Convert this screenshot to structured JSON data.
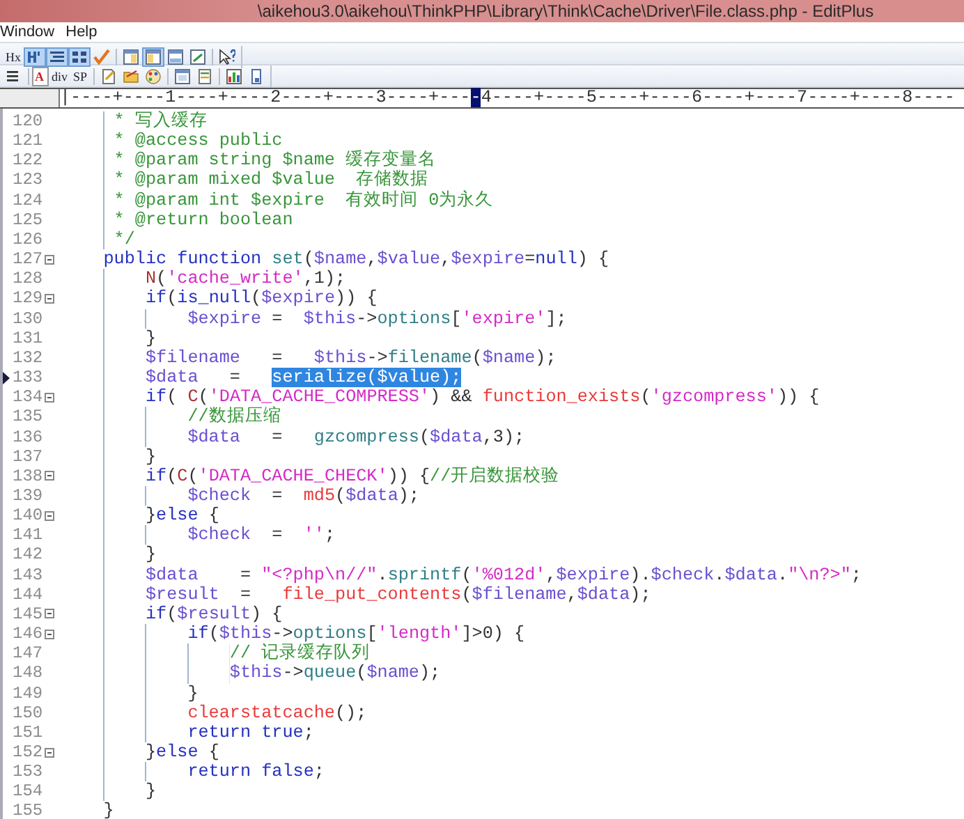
{
  "window": {
    "title": "\\aikehou3.0\\aikehou\\ThinkPHP\\Library\\Think\\Cache\\Driver\\File.class.php - EditPlus"
  },
  "menu": [
    "Window",
    "Help"
  ],
  "toolbars": [
    {
      "items": [
        {
          "kind": "text",
          "label": "Hx",
          "pressed": false
        },
        {
          "kind": "icon",
          "pressed": true
        },
        {
          "kind": "icon",
          "pressed": true
        },
        {
          "kind": "icon",
          "pressed": true
        },
        {
          "kind": "icon",
          "pressed": false
        },
        {
          "kind": "separator"
        },
        {
          "kind": "icon",
          "pressed": false
        },
        {
          "kind": "icon",
          "pressed": true
        },
        {
          "kind": "icon",
          "pressed": false
        },
        {
          "kind": "icon",
          "pressed": false
        },
        {
          "kind": "separator"
        },
        {
          "kind": "icon",
          "pressed": false
        }
      ]
    },
    {
      "items": [
        {
          "kind": "icon",
          "pressed": false
        },
        {
          "kind": "separator"
        },
        {
          "kind": "boxed",
          "label": "A",
          "pressed": false
        },
        {
          "kind": "text",
          "label": "div",
          "pressed": false
        },
        {
          "kind": "text",
          "label": "SP",
          "pressed": false
        },
        {
          "kind": "separator"
        },
        {
          "kind": "icon",
          "pressed": false
        },
        {
          "kind": "icon",
          "pressed": false
        },
        {
          "kind": "icon",
          "pressed": false
        },
        {
          "kind": "separator"
        },
        {
          "kind": "icon",
          "pressed": false
        },
        {
          "kind": "icon",
          "pressed": false
        },
        {
          "kind": "separator"
        },
        {
          "kind": "icon",
          "pressed": false
        },
        {
          "kind": "icon",
          "pressed": false
        }
      ]
    }
  ],
  "ruler": {
    "before": "|----+----1----+----2----+----3----+---",
    "mark": "-",
    "after": "4----+----5----+----6----+----7----+----8----"
  },
  "editor": {
    "lines": [
      {
        "number": "120",
        "foldable": false,
        "current": false,
        "tokens": [
          {
            "kind": "comment",
            "text": "     * 写入缓存"
          }
        ]
      },
      {
        "number": "121",
        "foldable": false,
        "current": false,
        "tokens": [
          {
            "kind": "comment",
            "text": "     * @access public"
          }
        ]
      },
      {
        "number": "122",
        "foldable": false,
        "current": false,
        "tokens": [
          {
            "kind": "comment",
            "text": "     * @param string $name 缓存变量名"
          }
        ]
      },
      {
        "number": "123",
        "foldable": false,
        "current": false,
        "tokens": [
          {
            "kind": "comment",
            "text": "     * @param mixed $value  存储数据"
          }
        ]
      },
      {
        "number": "124",
        "foldable": false,
        "current": false,
        "tokens": [
          {
            "kind": "comment",
            "text": "     * @param int $expire  有效时间 0为永久"
          }
        ]
      },
      {
        "number": "125",
        "foldable": false,
        "current": false,
        "tokens": [
          {
            "kind": "comment",
            "text": "     * @return boolean"
          }
        ]
      },
      {
        "number": "126",
        "foldable": false,
        "current": false,
        "tokens": [
          {
            "kind": "comment",
            "text": "     */"
          }
        ]
      },
      {
        "number": "127",
        "foldable": true,
        "current": false,
        "tokens": [
          {
            "kind": "keyword",
            "text": "    public"
          },
          {
            "kind": "keyword",
            "text": " function"
          },
          {
            "kind": "ident",
            "text": " set"
          },
          {
            "kind": "plain",
            "text": "("
          },
          {
            "kind": "var",
            "text": "$name"
          },
          {
            "kind": "plain",
            "text": ","
          },
          {
            "kind": "var",
            "text": "$value"
          },
          {
            "kind": "plain",
            "text": ","
          },
          {
            "kind": "var",
            "text": "$expire"
          },
          {
            "kind": "plain",
            "text": "="
          },
          {
            "kind": "keyword",
            "text": "null"
          },
          {
            "kind": "plain",
            "text": ") {"
          }
        ]
      },
      {
        "number": "128",
        "foldable": false,
        "current": false,
        "tokens": [
          {
            "kind": "macro",
            "text": "        N"
          },
          {
            "kind": "plain",
            "text": "("
          },
          {
            "kind": "string",
            "text": "'cache_write'"
          },
          {
            "kind": "plain",
            "text": ",1);"
          }
        ]
      },
      {
        "number": "129",
        "foldable": true,
        "current": false,
        "tokens": [
          {
            "kind": "keyword",
            "text": "        if"
          },
          {
            "kind": "plain",
            "text": "("
          },
          {
            "kind": "keyword",
            "text": "is_null"
          },
          {
            "kind": "plain",
            "text": "("
          },
          {
            "kind": "var",
            "text": "$expire"
          },
          {
            "kind": "plain",
            "text": ")) {"
          }
        ]
      },
      {
        "number": "130",
        "foldable": false,
        "current": false,
        "tokens": [
          {
            "kind": "var",
            "text": "            $expire"
          },
          {
            "kind": "plain",
            "text": " =  "
          },
          {
            "kind": "var",
            "text": "$this"
          },
          {
            "kind": "plain",
            "text": "->"
          },
          {
            "kind": "ident",
            "text": "options"
          },
          {
            "kind": "plain",
            "text": "["
          },
          {
            "kind": "string",
            "text": "'expire'"
          },
          {
            "kind": "plain",
            "text": "];"
          }
        ]
      },
      {
        "number": "131",
        "foldable": false,
        "current": false,
        "tokens": [
          {
            "kind": "plain",
            "text": "        }"
          }
        ]
      },
      {
        "number": "132",
        "foldable": false,
        "current": false,
        "tokens": [
          {
            "kind": "var",
            "text": "        $filename"
          },
          {
            "kind": "plain",
            "text": "   =   "
          },
          {
            "kind": "var",
            "text": "$this"
          },
          {
            "kind": "plain",
            "text": "->"
          },
          {
            "kind": "ident",
            "text": "filename"
          },
          {
            "kind": "plain",
            "text": "("
          },
          {
            "kind": "var",
            "text": "$name"
          },
          {
            "kind": "plain",
            "text": ");"
          }
        ]
      },
      {
        "number": "133",
        "foldable": false,
        "current": true,
        "tokens": [
          {
            "kind": "var",
            "text": "        $data"
          },
          {
            "kind": "plain",
            "text": "   =   "
          },
          {
            "kind": "selection",
            "text": "serialize($value);"
          }
        ]
      },
      {
        "number": "134",
        "foldable": true,
        "current": false,
        "tokens": [
          {
            "kind": "keyword",
            "text": "        if"
          },
          {
            "kind": "plain",
            "text": "( "
          },
          {
            "kind": "macro",
            "text": "C"
          },
          {
            "kind": "plain",
            "text": "("
          },
          {
            "kind": "string",
            "text": "'DATA_CACHE_COMPRESS'"
          },
          {
            "kind": "plain",
            "text": ") && "
          },
          {
            "kind": "builtin",
            "text": "function_exists"
          },
          {
            "kind": "plain",
            "text": "("
          },
          {
            "kind": "string",
            "text": "'gzcompress'"
          },
          {
            "kind": "plain",
            "text": ")) {"
          }
        ]
      },
      {
        "number": "135",
        "foldable": false,
        "current": false,
        "tokens": [
          {
            "kind": "comment",
            "text": "            //数据压缩"
          }
        ]
      },
      {
        "number": "136",
        "foldable": false,
        "current": false,
        "tokens": [
          {
            "kind": "var",
            "text": "            $data"
          },
          {
            "kind": "plain",
            "text": "   =   "
          },
          {
            "kind": "ident",
            "text": "gzcompress"
          },
          {
            "kind": "plain",
            "text": "("
          },
          {
            "kind": "var",
            "text": "$data"
          },
          {
            "kind": "plain",
            "text": ",3);"
          }
        ]
      },
      {
        "number": "137",
        "foldable": false,
        "current": false,
        "tokens": [
          {
            "kind": "plain",
            "text": "        }"
          }
        ]
      },
      {
        "number": "138",
        "foldable": true,
        "current": false,
        "tokens": [
          {
            "kind": "keyword",
            "text": "        if"
          },
          {
            "kind": "plain",
            "text": "("
          },
          {
            "kind": "macro",
            "text": "C"
          },
          {
            "kind": "plain",
            "text": "("
          },
          {
            "kind": "string",
            "text": "'DATA_CACHE_CHECK'"
          },
          {
            "kind": "plain",
            "text": ")) {"
          },
          {
            "kind": "comment",
            "text": "//开启数据校验"
          }
        ]
      },
      {
        "number": "139",
        "foldable": false,
        "current": false,
        "tokens": [
          {
            "kind": "var",
            "text": "            $check"
          },
          {
            "kind": "plain",
            "text": "  =  "
          },
          {
            "kind": "builtin",
            "text": "md5"
          },
          {
            "kind": "plain",
            "text": "("
          },
          {
            "kind": "var",
            "text": "$data"
          },
          {
            "kind": "plain",
            "text": ");"
          }
        ]
      },
      {
        "number": "140",
        "foldable": true,
        "current": false,
        "tokens": [
          {
            "kind": "plain",
            "text": "        }"
          },
          {
            "kind": "keyword",
            "text": "else"
          },
          {
            "kind": "plain",
            "text": " {"
          }
        ]
      },
      {
        "number": "141",
        "foldable": false,
        "current": false,
        "tokens": [
          {
            "kind": "var",
            "text": "            $check"
          },
          {
            "kind": "plain",
            "text": "  =  "
          },
          {
            "kind": "string",
            "text": "''"
          },
          {
            "kind": "plain",
            "text": ";"
          }
        ]
      },
      {
        "number": "142",
        "foldable": false,
        "current": false,
        "tokens": [
          {
            "kind": "plain",
            "text": "        }"
          }
        ]
      },
      {
        "number": "143",
        "foldable": false,
        "current": false,
        "tokens": [
          {
            "kind": "var",
            "text": "        $data"
          },
          {
            "kind": "plain",
            "text": "    = "
          },
          {
            "kind": "string",
            "text": "\"<?php\\n//\""
          },
          {
            "kind": "plain",
            "text": "."
          },
          {
            "kind": "ident",
            "text": "sprintf"
          },
          {
            "kind": "plain",
            "text": "("
          },
          {
            "kind": "string",
            "text": "'%012d'"
          },
          {
            "kind": "plain",
            "text": ","
          },
          {
            "kind": "var",
            "text": "$expire"
          },
          {
            "kind": "plain",
            "text": ")."
          },
          {
            "kind": "var",
            "text": "$check"
          },
          {
            "kind": "plain",
            "text": "."
          },
          {
            "kind": "var",
            "text": "$data"
          },
          {
            "kind": "plain",
            "text": "."
          },
          {
            "kind": "string",
            "text": "\"\\n?>\""
          },
          {
            "kind": "plain",
            "text": ";"
          }
        ]
      },
      {
        "number": "144",
        "foldable": false,
        "current": false,
        "tokens": [
          {
            "kind": "var",
            "text": "        $result"
          },
          {
            "kind": "plain",
            "text": "  =   "
          },
          {
            "kind": "builtin",
            "text": "file_put_contents"
          },
          {
            "kind": "plain",
            "text": "("
          },
          {
            "kind": "var",
            "text": "$filename"
          },
          {
            "kind": "plain",
            "text": ","
          },
          {
            "kind": "var",
            "text": "$data"
          },
          {
            "kind": "plain",
            "text": ");"
          }
        ]
      },
      {
        "number": "145",
        "foldable": true,
        "current": false,
        "tokens": [
          {
            "kind": "keyword",
            "text": "        if"
          },
          {
            "kind": "plain",
            "text": "("
          },
          {
            "kind": "var",
            "text": "$result"
          },
          {
            "kind": "plain",
            "text": ") {"
          }
        ]
      },
      {
        "number": "146",
        "foldable": true,
        "current": false,
        "tokens": [
          {
            "kind": "keyword",
            "text": "            if"
          },
          {
            "kind": "plain",
            "text": "("
          },
          {
            "kind": "var",
            "text": "$this"
          },
          {
            "kind": "plain",
            "text": "->"
          },
          {
            "kind": "ident",
            "text": "options"
          },
          {
            "kind": "plain",
            "text": "["
          },
          {
            "kind": "string",
            "text": "'length'"
          },
          {
            "kind": "plain",
            "text": "]>0) {"
          }
        ]
      },
      {
        "number": "147",
        "foldable": false,
        "current": false,
        "tokens": [
          {
            "kind": "comment",
            "text": "                // 记录缓存队列"
          }
        ]
      },
      {
        "number": "148",
        "foldable": false,
        "current": false,
        "tokens": [
          {
            "kind": "var",
            "text": "                $this"
          },
          {
            "kind": "plain",
            "text": "->"
          },
          {
            "kind": "ident",
            "text": "queue"
          },
          {
            "kind": "plain",
            "text": "("
          },
          {
            "kind": "var",
            "text": "$name"
          },
          {
            "kind": "plain",
            "text": ");"
          }
        ]
      },
      {
        "number": "149",
        "foldable": false,
        "current": false,
        "tokens": [
          {
            "kind": "plain",
            "text": "            }"
          }
        ]
      },
      {
        "number": "150",
        "foldable": false,
        "current": false,
        "tokens": [
          {
            "kind": "builtin",
            "text": "            clearstatcache"
          },
          {
            "kind": "plain",
            "text": "();"
          }
        ]
      },
      {
        "number": "151",
        "foldable": false,
        "current": false,
        "tokens": [
          {
            "kind": "keyword",
            "text": "            return"
          },
          {
            "kind": "keyword",
            "text": " true"
          },
          {
            "kind": "plain",
            "text": ";"
          }
        ]
      },
      {
        "number": "152",
        "foldable": true,
        "current": false,
        "tokens": [
          {
            "kind": "plain",
            "text": "        }"
          },
          {
            "kind": "keyword",
            "text": "else"
          },
          {
            "kind": "plain",
            "text": " {"
          }
        ]
      },
      {
        "number": "153",
        "foldable": false,
        "current": false,
        "tokens": [
          {
            "kind": "keyword",
            "text": "            return"
          },
          {
            "kind": "keyword",
            "text": " false"
          },
          {
            "kind": "plain",
            "text": ";"
          }
        ]
      },
      {
        "number": "154",
        "foldable": false,
        "current": false,
        "tokens": [
          {
            "kind": "plain",
            "text": "        }"
          }
        ]
      },
      {
        "number": "155",
        "foldable": false,
        "current": false,
        "tokens": [
          {
            "kind": "plain",
            "text": "    }"
          }
        ]
      }
    ]
  }
}
